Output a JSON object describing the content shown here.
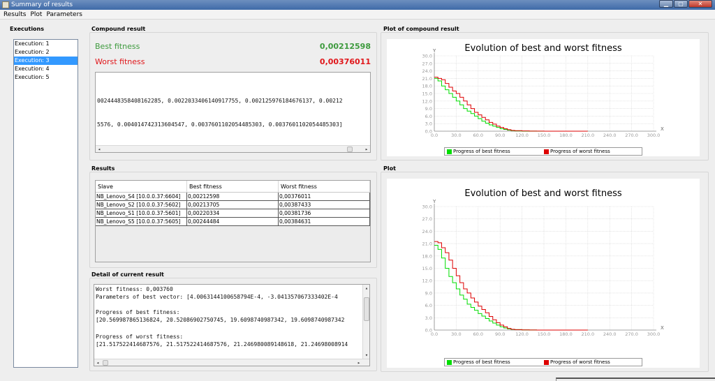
{
  "window": {
    "title": "Summary of results"
  },
  "menu": [
    "Results",
    "Plot",
    "Parameters"
  ],
  "executions": {
    "title": "Executions",
    "items": [
      "Execution: 1",
      "Execution: 2",
      "Execution: 3",
      "Execution: 4",
      "Execution: 5"
    ],
    "selected_index": 2
  },
  "compound": {
    "title": "Compound result",
    "best_label": "Best fitness",
    "best_value": "0,00212598",
    "worst_label": "Worst fitness",
    "worst_value": "0,00376011",
    "text_line1": "0024448358408162285, 0.0022033406140917755, 0.002125976184676137, 0.00212",
    "text_line2": "5576, 0.004014742313604547, 0.0037601102054485303, 0.0037601102054485303]"
  },
  "results": {
    "title": "Results",
    "columns": [
      "Slave",
      "Best fitness",
      "Worst fitness"
    ],
    "rows": [
      [
        "NB_Lenovo_S4 [10.0.0.37:6604]",
        "0,00212598",
        "0,00376011"
      ],
      [
        "NB_Lenovo_S2 [10.0.0.37:5602]",
        "0,00213705",
        "0,00387433"
      ],
      [
        "NB_Lenovo_S1 [10.0.0.37:5601]",
        "0,00220334",
        "0,00381736"
      ],
      [
        "NB_Lenovo_S5 [10.0.0.37:5605]",
        "0,00244484",
        "0,00384631"
      ]
    ]
  },
  "detail": {
    "title": "Detail of current result",
    "lines": [
      "Worst fitness: 0,003760",
      "Parameters of best vector: [4.0063144100658794E-4, -3.041357067333402E-4",
      "",
      "Progress of best fitness:",
      "[20.569987865136824, 20.52086902750745, 19.6098740987342, 19.6098740987342",
      "",
      "Progress of worst fitness:",
      "[21.517522414687576, 21.517522414687576, 21.246980089148618, 21.24698008914"
    ]
  },
  "plot_compound": {
    "section_title": "Plot of compound result"
  },
  "plot_current": {
    "section_title": "Plot"
  },
  "chart_data": [
    {
      "type": "line",
      "title": "Evolution of best and worst fitness",
      "xlabel": "X",
      "ylabel": "Y",
      "xlim": [
        0,
        300
      ],
      "ylim": [
        0,
        30
      ],
      "xticks": [
        "0.0",
        "30.0",
        "60.0",
        "90.0",
        "120.0",
        "150.0",
        "180.0",
        "210.0",
        "240.0",
        "270.0",
        "300.0"
      ],
      "yticks": [
        "0.0",
        "3.0",
        "6.0",
        "9.0",
        "12.0",
        "15.0",
        "18.0",
        "21.0",
        "24.0",
        "27.0",
        "30.0"
      ],
      "grid": true,
      "legend_placement": "bottom",
      "series": [
        {
          "name": "Progress of best fitness",
          "color": "#00dd00",
          "x": [
            0,
            5,
            10,
            15,
            20,
            25,
            30,
            35,
            40,
            45,
            50,
            55,
            60,
            65,
            70,
            75,
            80,
            85,
            90,
            95,
            100,
            105,
            110,
            120,
            130,
            140,
            150,
            160,
            170,
            180,
            190,
            200,
            210
          ],
          "y": [
            21.0,
            20.0,
            18.0,
            16.5,
            15.0,
            13.5,
            12.0,
            10.5,
            9.0,
            8.0,
            7.0,
            6.0,
            5.0,
            4.0,
            3.2,
            2.5,
            2.0,
            1.5,
            1.0,
            0.7,
            0.4,
            0.2,
            0.1,
            0.05,
            0.02,
            0.01,
            0.01,
            0.0,
            0.0,
            0.0,
            0.0,
            0.0,
            0.0
          ]
        },
        {
          "name": "Progress of worst fitness",
          "color": "#dd0000",
          "x": [
            0,
            5,
            10,
            15,
            20,
            25,
            30,
            35,
            40,
            45,
            50,
            55,
            60,
            65,
            70,
            75,
            80,
            85,
            90,
            95,
            100,
            105,
            110,
            120,
            130,
            140,
            150,
            160,
            170,
            180,
            190,
            200,
            210
          ],
          "y": [
            21.5,
            21.0,
            20.5,
            19.0,
            17.5,
            16.0,
            15.0,
            13.5,
            12.0,
            10.5,
            9.0,
            7.5,
            6.5,
            5.5,
            4.5,
            3.5,
            2.8,
            2.0,
            1.5,
            1.0,
            0.6,
            0.3,
            0.2,
            0.1,
            0.05,
            0.02,
            0.01,
            0.01,
            0.0,
            0.0,
            0.0,
            0.0,
            0.0
          ]
        }
      ]
    },
    {
      "type": "line",
      "title": "Evolution of best and worst fitness",
      "xlabel": "X",
      "ylabel": "Y",
      "xlim": [
        0,
        300
      ],
      "ylim": [
        0,
        30
      ],
      "xticks": [
        "0.0",
        "30.0",
        "60.0",
        "90.0",
        "120.0",
        "150.0",
        "180.0",
        "210.0",
        "240.0",
        "270.0",
        "300.0"
      ],
      "yticks": [
        "0.0",
        "3.0",
        "6.0",
        "9.0",
        "12.0",
        "15.0",
        "18.0",
        "21.0",
        "24.0",
        "27.0",
        "30.0"
      ],
      "grid": true,
      "legend_placement": "bottom",
      "series": [
        {
          "name": "Progress of best fitness",
          "color": "#00dd00",
          "x": [
            0,
            5,
            10,
            15,
            20,
            25,
            30,
            35,
            40,
            45,
            50,
            55,
            60,
            65,
            70,
            75,
            80,
            85,
            90,
            95,
            100,
            105,
            110,
            120,
            130,
            140,
            150,
            160,
            170,
            180,
            190,
            200,
            210
          ],
          "y": [
            20.6,
            19.6,
            17.5,
            15.0,
            13.0,
            11.5,
            10.0,
            8.5,
            7.5,
            6.3,
            5.5,
            4.8,
            4.0,
            3.4,
            2.8,
            2.2,
            1.7,
            1.2,
            0.8,
            0.5,
            0.3,
            0.15,
            0.1,
            0.05,
            0.02,
            0.01,
            0.0,
            0.0,
            0.0,
            0.0,
            0.0,
            0.0,
            0.0
          ]
        },
        {
          "name": "Progress of worst fitness",
          "color": "#dd0000",
          "x": [
            0,
            5,
            10,
            15,
            20,
            25,
            30,
            35,
            40,
            45,
            50,
            55,
            60,
            65,
            70,
            75,
            80,
            85,
            90,
            95,
            100,
            105,
            110,
            120,
            130,
            140,
            150,
            160,
            170,
            180,
            190,
            200,
            210
          ],
          "y": [
            21.5,
            21.2,
            20.0,
            18.8,
            17.0,
            15.0,
            13.2,
            11.5,
            10.0,
            9.0,
            7.8,
            6.8,
            5.8,
            5.0,
            4.2,
            3.3,
            2.5,
            1.8,
            1.2,
            0.8,
            0.4,
            0.2,
            0.1,
            0.05,
            0.02,
            0.01,
            0.0,
            0.0,
            0.0,
            0.0,
            0.0,
            0.0,
            0.0
          ]
        }
      ]
    }
  ]
}
